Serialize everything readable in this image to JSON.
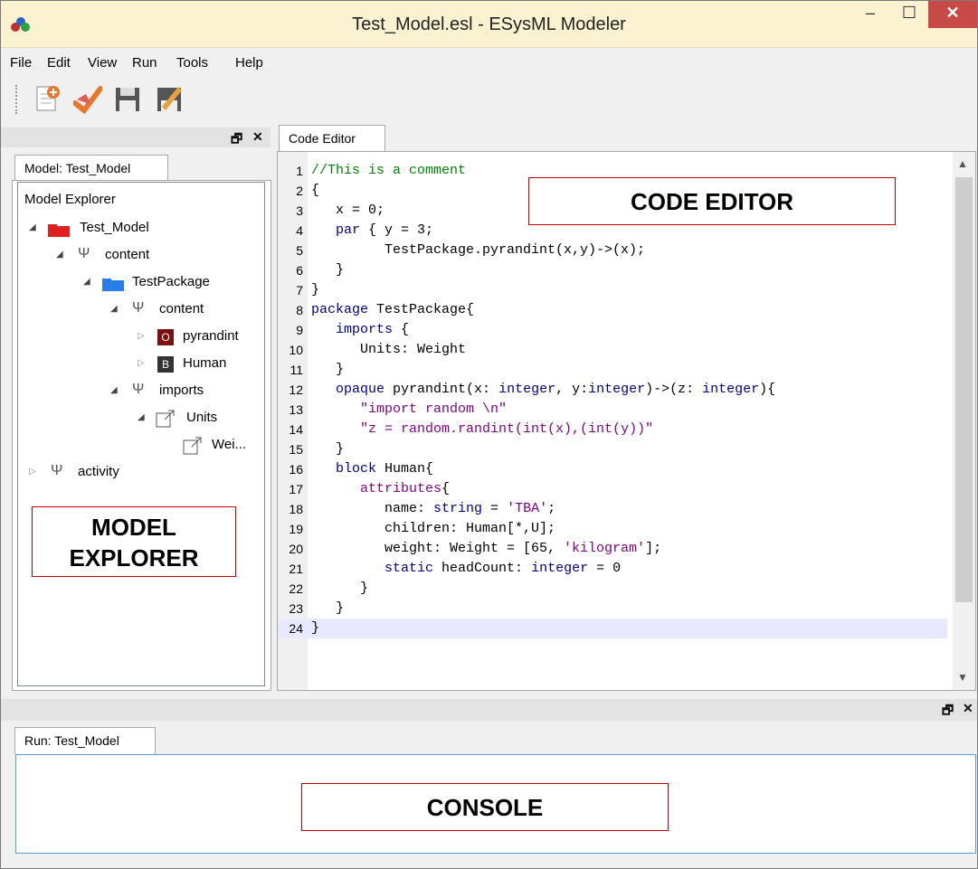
{
  "window": {
    "title": "Test_Model.esl - ESysML Modeler",
    "minimize": "–",
    "maximize": "☐",
    "close": "✕"
  },
  "menu": [
    "File",
    "Edit",
    "View",
    "Run",
    "Tools",
    "Help"
  ],
  "toolbar": {
    "buttons": [
      "new-file-icon",
      "check-model-icon",
      "save-icon",
      "edit-save-icon"
    ]
  },
  "left_dock": {
    "float_label": "🗗",
    "close_label": "✕",
    "tab": "Model: Test_Model",
    "explorer_title": "Model Explorer",
    "tree": [
      {
        "label": "Test_Model",
        "icon": "red-folder-icon"
      },
      {
        "label": "content",
        "icon": "fork-icon"
      },
      {
        "label": "TestPackage",
        "icon": "blue-folder-icon"
      },
      {
        "label": "content",
        "icon": "fork-icon"
      },
      {
        "label": "pyrandint",
        "badge": "O"
      },
      {
        "label": "Human",
        "badge": "B"
      },
      {
        "label": "imports",
        "icon": "fork-icon"
      },
      {
        "label": "Units",
        "icon": "link-out-icon"
      },
      {
        "label": "Wei...",
        "icon": "link-out-icon"
      },
      {
        "label": "activity",
        "icon": "fork-icon"
      }
    ]
  },
  "editor": {
    "tab": "Code Editor",
    "lines": [
      {
        "n": "1",
        "parts": [
          {
            "t": "//This is a comment",
            "c": "cm"
          }
        ]
      },
      {
        "n": "2",
        "parts": [
          {
            "t": "{",
            "c": ""
          }
        ]
      },
      {
        "n": "3",
        "parts": [
          {
            "t": "   x = 0;",
            "c": ""
          }
        ]
      },
      {
        "n": "4",
        "parts": [
          {
            "t": "   ",
            "c": ""
          },
          {
            "t": "par",
            "c": "kw"
          },
          {
            "t": " { y = 3;",
            "c": ""
          }
        ]
      },
      {
        "n": "5",
        "parts": [
          {
            "t": "         TestPackage.pyrandint(x,y)->(x);",
            "c": ""
          }
        ]
      },
      {
        "n": "6",
        "parts": [
          {
            "t": "   }",
            "c": ""
          }
        ]
      },
      {
        "n": "7",
        "parts": [
          {
            "t": "}",
            "c": ""
          }
        ]
      },
      {
        "n": "8",
        "parts": [
          {
            "t": "package",
            "c": "kw"
          },
          {
            "t": " TestPackage{",
            "c": ""
          }
        ]
      },
      {
        "n": "9",
        "parts": [
          {
            "t": "   ",
            "c": ""
          },
          {
            "t": "imports",
            "c": "kw"
          },
          {
            "t": " {",
            "c": ""
          }
        ]
      },
      {
        "n": "10",
        "parts": [
          {
            "t": "      Units: Weight",
            "c": ""
          }
        ]
      },
      {
        "n": "11",
        "parts": [
          {
            "t": "   }",
            "c": ""
          }
        ]
      },
      {
        "n": "12",
        "parts": [
          {
            "t": "   ",
            "c": ""
          },
          {
            "t": "opaque",
            "c": "kw"
          },
          {
            "t": " pyrandint(x: ",
            "c": ""
          },
          {
            "t": "integer",
            "c": "kw"
          },
          {
            "t": ", y:",
            "c": ""
          },
          {
            "t": "integer",
            "c": "kw"
          },
          {
            "t": ")->(z: ",
            "c": ""
          },
          {
            "t": "integer",
            "c": "kw"
          },
          {
            "t": "){",
            "c": ""
          }
        ]
      },
      {
        "n": "13",
        "parts": [
          {
            "t": "      ",
            "c": ""
          },
          {
            "t": "\"import random \\n\"",
            "c": "st"
          }
        ]
      },
      {
        "n": "14",
        "parts": [
          {
            "t": "      ",
            "c": ""
          },
          {
            "t": "\"z = random.randint(int(x),(int(y))\"",
            "c": "st"
          }
        ]
      },
      {
        "n": "15",
        "parts": [
          {
            "t": "   }",
            "c": ""
          }
        ]
      },
      {
        "n": "16",
        "parts": [
          {
            "t": "   ",
            "c": ""
          },
          {
            "t": "block",
            "c": "kw"
          },
          {
            "t": " Human{",
            "c": ""
          }
        ]
      },
      {
        "n": "17",
        "parts": [
          {
            "t": "      ",
            "c": ""
          },
          {
            "t": "attributes",
            "c": "st"
          },
          {
            "t": "{",
            "c": ""
          }
        ]
      },
      {
        "n": "18",
        "parts": [
          {
            "t": "         name: ",
            "c": ""
          },
          {
            "t": "string",
            "c": "kw"
          },
          {
            "t": " = ",
            "c": ""
          },
          {
            "t": "'TBA'",
            "c": "st"
          },
          {
            "t": ";",
            "c": ""
          }
        ]
      },
      {
        "n": "19",
        "parts": [
          {
            "t": "         children: Human[*,U];",
            "c": ""
          }
        ]
      },
      {
        "n": "20",
        "parts": [
          {
            "t": "         weight: Weight = [65, ",
            "c": ""
          },
          {
            "t": "'kilogram'",
            "c": "st"
          },
          {
            "t": "];",
            "c": ""
          }
        ]
      },
      {
        "n": "21",
        "parts": [
          {
            "t": "         ",
            "c": ""
          },
          {
            "t": "static",
            "c": "kw"
          },
          {
            "t": " headCount: ",
            "c": ""
          },
          {
            "t": "integer",
            "c": "kw"
          },
          {
            "t": " = 0",
            "c": ""
          }
        ]
      },
      {
        "n": "22",
        "parts": [
          {
            "t": "      }",
            "c": ""
          }
        ]
      },
      {
        "n": "23",
        "parts": [
          {
            "t": "   }",
            "c": ""
          }
        ]
      },
      {
        "n": "24",
        "parts": [
          {
            "t": "}",
            "c": ""
          }
        ]
      }
    ]
  },
  "bottom_dock": {
    "float_label": "🗗",
    "close_label": "✕",
    "tab": "Run: Test_Model"
  },
  "annotations": {
    "code_editor": "CODE EDITOR",
    "model_explorer": "MODEL\nEXPLORER",
    "console": "CONSOLE"
  },
  "colors": {
    "titlebar": "#fbf2d2",
    "close_button": "#c84a46",
    "keyword": "#00007f",
    "comment": "#007f00",
    "string": "#7f007f",
    "annotation_border": "#c00000"
  }
}
